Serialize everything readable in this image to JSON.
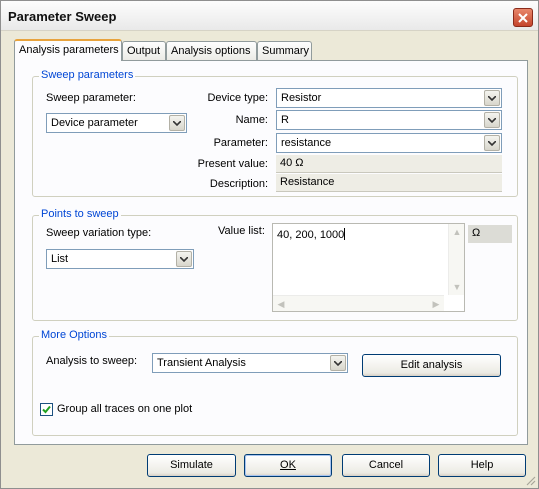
{
  "window": {
    "title": "Parameter Sweep",
    "close_icon": "close-icon"
  },
  "tabs": [
    {
      "label": "Analysis parameters",
      "active": true
    },
    {
      "label": "Output",
      "active": false
    },
    {
      "label": "Analysis options",
      "active": false
    },
    {
      "label": "Summary",
      "active": false
    }
  ],
  "sweep_parameters": {
    "group_title": "Sweep parameters",
    "sweep_parameter_label": "Sweep parameter:",
    "sweep_parameter_value": "Device parameter",
    "device_type_label": "Device type:",
    "device_type_value": "Resistor",
    "name_label": "Name:",
    "name_value": "R",
    "parameter_label": "Parameter:",
    "parameter_value": "resistance",
    "present_value_label": "Present value:",
    "present_value": "40 Ω",
    "description_label": "Description:",
    "description_value": "Resistance"
  },
  "points_to_sweep": {
    "group_title": "Points to sweep",
    "variation_type_label": "Sweep variation type:",
    "variation_type_value": "List",
    "value_list_label": "Value list:",
    "value_list": "40, 200, 1000",
    "unit": "Ω"
  },
  "more_options": {
    "group_title": "More Options",
    "analysis_label": "Analysis to sweep:",
    "analysis_value": "Transient Analysis",
    "edit_analysis_label": "Edit analysis",
    "group_traces_label": "Group all traces on one plot",
    "group_traces_checked": true
  },
  "footer": {
    "simulate_label": "Simulate",
    "ok_label": "OK",
    "cancel_label": "Cancel",
    "help_label": "Help"
  },
  "colors": {
    "group_title": "#0046d5",
    "active_tab_accent": "#e8a33c",
    "dialog_bg": "#ece9d8"
  }
}
